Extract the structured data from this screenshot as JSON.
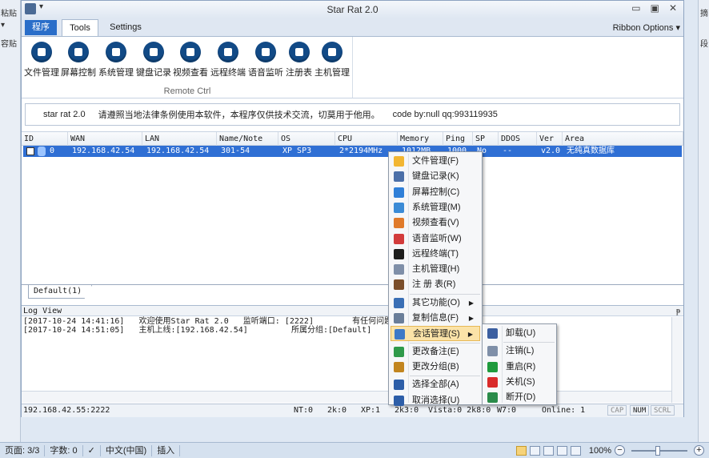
{
  "bg_left": [
    "粘贴",
    "▾",
    "容贴"
  ],
  "bg_right": [
    "摘",
    "段"
  ],
  "word_status": {
    "page": "页面: 3/3",
    "words": "字数: 0",
    "lang": "中文(中国)",
    "insert": "插入",
    "zoom": "100%",
    "zoom_minus": "−",
    "zoom_plus": "+"
  },
  "app": {
    "title": "Star Rat 2.0",
    "quick_access_arrow": "▾",
    "win_controls": [
      "▭",
      "▣",
      "✕"
    ],
    "tabs": {
      "app": "程序",
      "tools": "Tools",
      "settings": "Settings"
    },
    "ribbon_options": "Ribbon Options ▾",
    "ribbon_buttons": [
      "文件管理",
      "屏幕控制",
      "系统管理",
      "键盘记录",
      "视频查看",
      "远程终端",
      "语音监听",
      "注册表",
      "主机管理"
    ],
    "ribbon_group_label": "Remote Ctrl",
    "banner": {
      "name": "star rat 2.0",
      "notice": "请遵照当地法律条例使用本软件，本程序仅供技术交流，切莫用于他用。",
      "code": "code by:null qq:993119935"
    }
  },
  "list": {
    "columns": [
      "ID",
      "WAN",
      "LAN",
      "Name/Note",
      "OS",
      "CPU",
      "Memory",
      "Ping",
      "SP",
      "DDOS",
      "Ver",
      "Area"
    ],
    "rows": [
      [
        "0",
        "192.168.42.54",
        "192.168.42.54",
        "301-54",
        "XP SP3",
        "2*2194MHz",
        "1012MB",
        "1000",
        "No",
        "--",
        "v2.0",
        "无纯真数据库"
      ]
    ],
    "group_tab": "Default(1)"
  },
  "log": {
    "title": "Log View",
    "pin": "ᵽ",
    "lines": [
      "[2017-10-24 14:41:16]   欢迎使用Star Rat 2.0   监听端口: [2222]        有任何问题可与作者联系",
      "[2017-10-24 14:51:05]   主机上线:[192.168.42.54]         所属分组:[Default]"
    ]
  },
  "app_status": {
    "addr": "192.168.42.55:2222",
    "nt": "NT:0",
    "k2": "2k:0",
    "xp": "XP:1",
    "k3": "2k3:0",
    "vista": "Vista:0 2k8:0",
    "w7": "W7:0",
    "online": "Online: 1",
    "caps": "CAP",
    "num": "NUM",
    "scrl": "SCRL"
  },
  "context_menu": {
    "items": [
      {
        "label": "文件管理(F)",
        "icon": "folder-icon",
        "color": "#f2b632"
      },
      {
        "label": "键盘记录(K)",
        "icon": "keyboard-icon",
        "color": "#4b6fa8"
      },
      {
        "label": "屏幕控制(C)",
        "icon": "monitor-icon",
        "color": "#2f7fd8"
      },
      {
        "label": "系统管理(M)",
        "icon": "gears-icon",
        "color": "#3b8bd6"
      },
      {
        "label": "视频查看(V)",
        "icon": "webcam-icon",
        "color": "#e07a2a"
      },
      {
        "label": "语音监听(W)",
        "icon": "megaphone-icon",
        "color": "#d23b3b"
      },
      {
        "label": "远程终端(T)",
        "icon": "terminal-icon",
        "color": "#1c1c1c"
      },
      {
        "label": "主机管理(H)",
        "icon": "host-icon",
        "color": "#7f8fa8"
      },
      {
        "label": "注 册 表(R)",
        "icon": "magnifier-icon",
        "color": "#7a4e2b"
      },
      {
        "label": "其它功能(O)",
        "icon": "tools-icon",
        "color": "#3a6fb5",
        "submenu": true
      },
      {
        "label": "复制信息(F)",
        "icon": "copy-icon",
        "color": "#6a7e99",
        "submenu": true
      },
      {
        "label": "会话管理(S)",
        "icon": "session-icon",
        "color": "#3d79c7",
        "submenu": true,
        "highlight": true
      },
      {
        "label": "更改备注(E)",
        "icon": "note-icon",
        "color": "#2f9a4a"
      },
      {
        "label": "更改分组(B)",
        "icon": "group-icon",
        "color": "#c2851f"
      },
      {
        "label": "选择全部(A)",
        "icon": "check-all-icon",
        "color": "#2d5ea8"
      },
      {
        "label": "取消选择(U)",
        "icon": "uncheck-icon",
        "color": "#2d5ea8"
      }
    ]
  },
  "sub_menu": {
    "items": [
      {
        "label": "卸载(U)",
        "icon": "uninstall-icon",
        "color": "#3c5fa0"
      },
      {
        "label": "注销(L)",
        "icon": "logoff-icon",
        "color": "#7f8fa8"
      },
      {
        "label": "重启(R)",
        "icon": "restart-icon",
        "color": "#1e9a3c"
      },
      {
        "label": "关机(S)",
        "icon": "shutdown-icon",
        "color": "#d92a2a"
      },
      {
        "label": "断开(D)",
        "icon": "disconnect-icon",
        "color": "#2a8b4a"
      }
    ]
  }
}
